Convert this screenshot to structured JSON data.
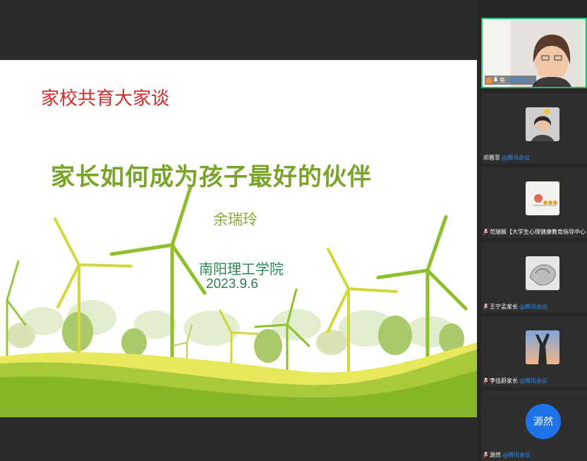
{
  "slide": {
    "header": "家校共育大家谈",
    "title": "家长如何成为孩子最好的伙伴",
    "author": "余瑞玲",
    "org": "南阳理工学院",
    "date": "2023.9.6"
  },
  "participants": [
    {
      "name": "鱼",
      "tag": "@腾讯会议",
      "active": true
    },
    {
      "name": "邓雅菲",
      "tag": "@腾讯会议"
    },
    {
      "name": "范瑞颖【大学生心理健康教育指导中心",
      "tag": ""
    },
    {
      "name": "王宁孟家长",
      "tag": "@腾讯会议"
    },
    {
      "name": "李佳蔚家长",
      "tag": "@腾讯会议"
    },
    {
      "name": "源然",
      "tag": "@腾讯会议",
      "initials": "源然"
    }
  ],
  "colors": {
    "accent_green": "#1fb86f",
    "meeting_tag": "#2d8cf0",
    "avatar_blue": "#1e73e8"
  }
}
